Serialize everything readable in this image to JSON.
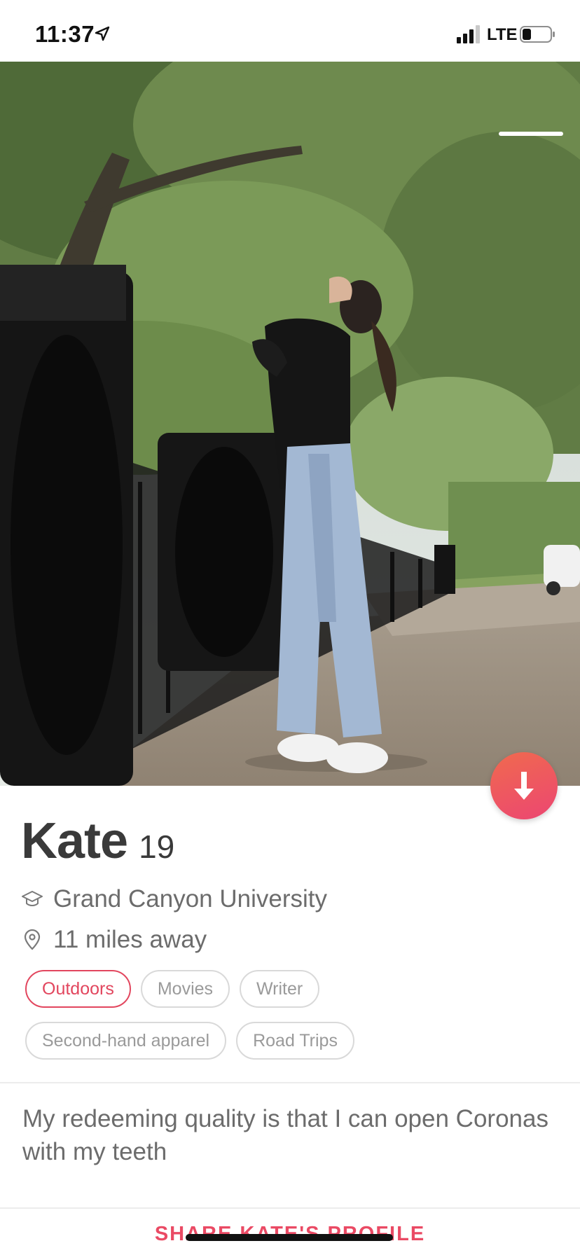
{
  "status_bar": {
    "time": "11:37",
    "network": "LTE",
    "icons": [
      "location-arrow-icon",
      "signal-icon",
      "battery-icon"
    ]
  },
  "profile": {
    "name": "Kate",
    "age": "19",
    "school": "Grand Canyon University",
    "distance": "11 miles away",
    "school_icon": "graduation-cap-icon",
    "distance_icon": "location-pin-icon",
    "interests": [
      {
        "label": "Outdoors",
        "shared": true
      },
      {
        "label": "Movies",
        "shared": false
      },
      {
        "label": "Writer",
        "shared": false
      },
      {
        "label": "Second-hand apparel",
        "shared": false
      },
      {
        "label": "Road Trips",
        "shared": false
      }
    ],
    "bio": "My redeeming quality is that I can open Coronas with my teeth"
  },
  "actions": {
    "collapse_icon": "arrow-down-icon",
    "share_label": "SHARE KATE'S PROFILE"
  },
  "colors": {
    "accent": "#ea4a64",
    "button_gradient_start": "#f06a4e",
    "button_gradient_end": "#ec4672"
  }
}
